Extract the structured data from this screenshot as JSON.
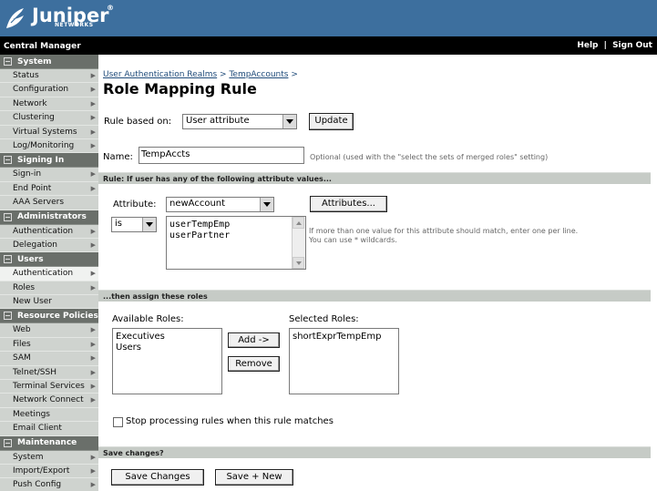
{
  "header": {
    "logo_text": "Juniper",
    "logo_sub": "NETWORKS",
    "logo_reg": "®",
    "colors": {
      "header_bg": "#3d6f9e",
      "topbar_bg": "#000000"
    }
  },
  "topbar": {
    "title": "Central Manager",
    "help": "Help",
    "separator": "|",
    "signout": "Sign Out"
  },
  "sidebar": {
    "sections": [
      {
        "title": "System",
        "items": [
          {
            "label": "Status",
            "arrow": true
          },
          {
            "label": "Configuration",
            "arrow": true
          },
          {
            "label": "Network",
            "arrow": true
          },
          {
            "label": "Clustering",
            "arrow": true
          },
          {
            "label": "Virtual Systems",
            "arrow": true
          },
          {
            "label": "Log/Monitoring",
            "arrow": true
          }
        ]
      },
      {
        "title": "Signing In",
        "items": [
          {
            "label": "Sign-in",
            "arrow": true
          },
          {
            "label": "End Point",
            "arrow": true
          },
          {
            "label": "AAA Servers",
            "arrow": false
          }
        ]
      },
      {
        "title": "Administrators",
        "items": [
          {
            "label": "Authentication",
            "arrow": true
          },
          {
            "label": "Delegation",
            "arrow": true
          }
        ]
      },
      {
        "title": "Users",
        "items": [
          {
            "label": "Authentication",
            "arrow": true
          },
          {
            "label": "Roles",
            "arrow": true
          },
          {
            "label": "New User",
            "arrow": false
          }
        ]
      },
      {
        "title": "Resource Policies",
        "items": [
          {
            "label": "Web",
            "arrow": true
          },
          {
            "label": "Files",
            "arrow": true
          },
          {
            "label": "SAM",
            "arrow": true
          },
          {
            "label": "Telnet/SSH",
            "arrow": true
          },
          {
            "label": "Terminal Services",
            "arrow": true
          },
          {
            "label": "Network Connect",
            "arrow": true
          },
          {
            "label": "Meetings",
            "arrow": false
          },
          {
            "label": "Email Client",
            "arrow": false
          }
        ]
      },
      {
        "title": "Maintenance",
        "items": [
          {
            "label": "System",
            "arrow": true
          },
          {
            "label": "Import/Export",
            "arrow": true
          },
          {
            "label": "Push Config",
            "arrow": true
          }
        ]
      }
    ]
  },
  "main": {
    "breadcrumb": {
      "link1": "User Authentication Realms",
      "sep1": " > ",
      "link2": "TempAccounts",
      "sep2": " >"
    },
    "title": "Role Mapping Rule",
    "rule_based_on": {
      "label": "Rule based on:",
      "value": "User attribute",
      "update_button": "Update"
    },
    "name": {
      "label": "Name:",
      "value": "TempAccts",
      "hint": "Optional (used with the \"select the sets of merged roles\" setting)"
    },
    "rule_section": {
      "header": "Rule: If user has any of the following attribute values...",
      "attribute_label": "Attribute:",
      "attribute_value": "newAccount",
      "attributes_button": "Attributes...",
      "operator": "is",
      "values": [
        "userTempEmp",
        "userPartner"
      ],
      "hint_line1": "If more than one value for this attribute should match, enter one per line.",
      "hint_line2": "You can use * wildcards."
    },
    "assign_section": {
      "header": "...then assign these roles",
      "available_label": "Available Roles:",
      "available": [
        "Executives",
        "Users"
      ],
      "add_button": "Add ->",
      "remove_button": "Remove",
      "selected_label": "Selected Roles:",
      "selected": [
        "shortExprTempEmp"
      ],
      "stop_label": "Stop processing rules when this rule matches",
      "stop_checked": false
    },
    "save_section": {
      "header": "Save changes?",
      "save_button": "Save Changes",
      "save_new_button": "Save + New"
    }
  }
}
